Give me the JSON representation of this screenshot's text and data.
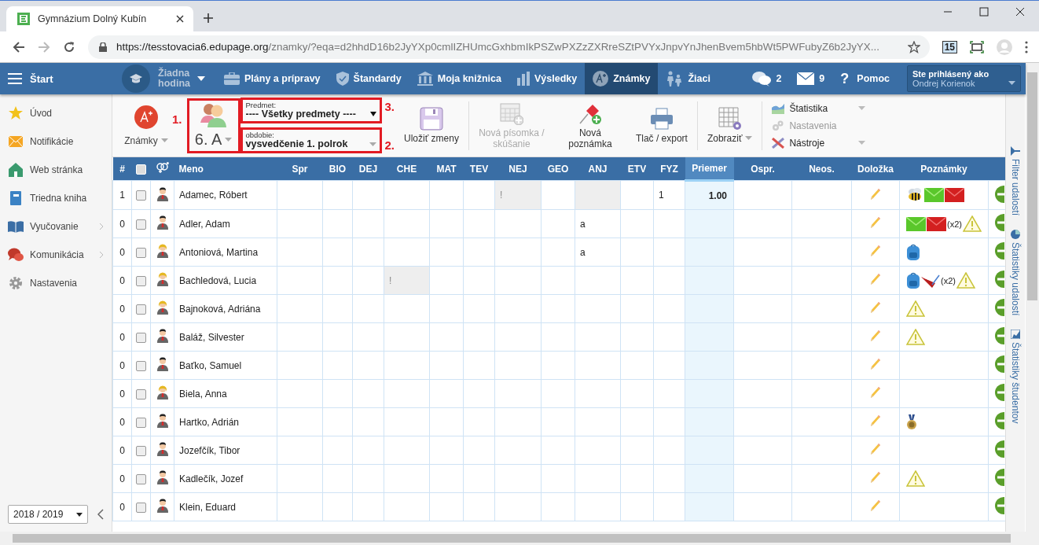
{
  "browser": {
    "tab_title": "Gymnázium Dolný Kubín",
    "url_host": "https://tesstovacia6.edupage.org",
    "url_path": "/znamky/?eqa=d2hhdD16b2JyYXp0cmlIZHUmcGxhbmIkPSZwPXZzZXRreSZtPVYxJnpvYnJhenBvem5hbWt5PWFubyZ6b2JyYX...",
    "extension_badge": "15"
  },
  "nav": {
    "start": "Štart",
    "lesson": "Žiadna hodina",
    "items": [
      {
        "label": "Plány a prípravy",
        "kind": "briefcase",
        "selected": false
      },
      {
        "label": "Štandardy",
        "kind": "shield",
        "selected": false
      },
      {
        "label": "Moja knižnica",
        "kind": "library",
        "selected": false
      },
      {
        "label": "Výsledky",
        "kind": "chart",
        "selected": false
      },
      {
        "label": "Známky",
        "kind": "grade",
        "selected": true
      },
      {
        "label": "Žiaci",
        "kind": "pupils",
        "selected": false
      }
    ],
    "chats": "2",
    "mails": "9",
    "help_glyph": "?",
    "help": "Pomoc",
    "user_caption": "Ste prihlásený ako",
    "user_name": "Ondrej Korienok"
  },
  "sidebar": {
    "items": [
      {
        "label": "Úvod",
        "kind": "star",
        "submenu": false
      },
      {
        "label": "Notifikácie",
        "kind": "mail",
        "submenu": false
      },
      {
        "label": "Web stránka",
        "kind": "home",
        "submenu": false
      },
      {
        "label": "Triedna kniha",
        "kind": "book",
        "submenu": false
      },
      {
        "label": "Vyučovanie",
        "kind": "open-book",
        "submenu": true
      },
      {
        "label": "Komunikácia",
        "kind": "chat",
        "submenu": true
      },
      {
        "label": "Nastavenia",
        "kind": "gear",
        "submenu": false
      }
    ],
    "year": "2018 / 2019"
  },
  "toolbar": {
    "grades_menu": {
      "label": "Známky",
      "marker": "1."
    },
    "class_picker": {
      "label": "6. A",
      "highlighted": true
    },
    "subject": {
      "caption": "Predmet:",
      "value": "---- Všetky predmety ----",
      "highlighted": true,
      "marker": "3."
    },
    "period": {
      "caption": "obdobie:",
      "value": "vysvedčenie 1. polrok",
      "highlighted": true,
      "marker": "2."
    },
    "buttons": [
      {
        "label": "Uložiť zmeny",
        "kind": "save",
        "disabled": false
      },
      {
        "label": "Nová písomka / skúšanie",
        "kind": "test",
        "disabled": true
      },
      {
        "label": "Nová poznámka",
        "kind": "pin",
        "disabled": false
      },
      {
        "label": "Tlač / export",
        "kind": "print",
        "disabled": false
      }
    ],
    "view": "Zobraziť",
    "menu": [
      {
        "label": "Štatistika",
        "kind": "stats",
        "disabled": false,
        "dropdown": true
      },
      {
        "label": "Nastavenia",
        "kind": "gears",
        "disabled": true,
        "dropdown": false
      },
      {
        "label": "Nástroje",
        "kind": "tools",
        "disabled": false,
        "dropdown": true
      }
    ]
  },
  "table": {
    "columns": [
      {
        "label": "#",
        "kind": "number",
        "highlighted": false
      },
      {
        "kind": "checkbox",
        "checked": false
      },
      {
        "kind": "gender"
      },
      {
        "label": "Meno",
        "kind": "name",
        "highlighted": false
      },
      {
        "label": "Spr",
        "kind": "grade",
        "highlighted": false
      },
      {
        "label": "BIO",
        "kind": "grade",
        "highlighted": false
      },
      {
        "label": "DEJ",
        "kind": "grade",
        "highlighted": false
      },
      {
        "label": "CHE",
        "kind": "grade",
        "highlighted": false
      },
      {
        "label": "MAT",
        "kind": "grade",
        "highlighted": false
      },
      {
        "label": "TEV",
        "kind": "grade",
        "highlighted": false
      },
      {
        "label": "NEJ",
        "kind": "grade",
        "highlighted": false
      },
      {
        "label": "GEO",
        "kind": "grade",
        "highlighted": false
      },
      {
        "label": "ANJ",
        "kind": "grade",
        "highlighted": false
      },
      {
        "label": "ETV",
        "kind": "grade",
        "highlighted": false
      },
      {
        "label": "FYZ",
        "kind": "grade",
        "highlighted": false
      },
      {
        "label": "Priemer",
        "kind": "grade",
        "highlighted": true
      },
      {
        "label": "Ospr.",
        "kind": "grade",
        "highlighted": false
      },
      {
        "label": "Neos.",
        "kind": "grade",
        "highlighted": false
      },
      {
        "label": "Doložka",
        "kind": "edit",
        "highlighted": false
      },
      {
        "label": "Poznámky",
        "kind": "notes",
        "highlighted": false
      }
    ],
    "rows": [
      {
        "cells": [
          "1",
          {
            "checked": false
          },
          {
            "female": false
          },
          "Adamec, Róbert",
          "",
          "",
          "",
          "",
          "",
          "",
          {
            "text": "!",
            "shaded": true
          },
          "",
          {
            "shaded": true
          },
          "",
          "1",
          "1.00",
          "",
          "",
          "",
          {
            "notes": [
              {
                "kind": "bee"
              },
              {
                "kind": "mail-green"
              },
              {
                "kind": "mail-red"
              }
            ]
          }
        ]
      },
      {
        "cells": [
          "0",
          {
            "checked": false
          },
          {
            "female": false
          },
          "Adler, Adam",
          "",
          "",
          "",
          "",
          "",
          "",
          "",
          "",
          "a",
          "",
          "",
          "",
          "",
          "",
          "",
          {
            "notes": [
              {
                "kind": "mail-green"
              },
              {
                "kind": "mail-red"
              },
              {
                "kind": "count",
                "text": "(x2)"
              },
              {
                "kind": "warning"
              }
            ]
          }
        ]
      },
      {
        "cells": [
          "0",
          {
            "checked": false
          },
          {
            "female": true
          },
          "Antoniová, Martina",
          "",
          "",
          "",
          "",
          "",
          "",
          "",
          "",
          "a",
          "",
          "",
          "",
          "",
          "",
          "",
          {
            "notes": [
              {
                "kind": "backpack"
              }
            ]
          }
        ]
      },
      {
        "cells": [
          "0",
          {
            "checked": false
          },
          {
            "female": true
          },
          "Bachledová, Lucia",
          "",
          "",
          "",
          {
            "text": "!",
            "shaded": true
          },
          "",
          "",
          "",
          "",
          "",
          "",
          "",
          "",
          "",
          "",
          "",
          {
            "notes": [
              {
                "kind": "backpack"
              },
              {
                "kind": "pen"
              },
              {
                "kind": "count",
                "text": "(x2)"
              },
              {
                "kind": "warning"
              }
            ]
          }
        ]
      },
      {
        "cells": [
          "0",
          {
            "checked": false
          },
          {
            "female": true
          },
          "Bajnoková, Adriána",
          "",
          "",
          "",
          "",
          "",
          "",
          "",
          "",
          "",
          "",
          "",
          "",
          "",
          "",
          "",
          {
            "notes": [
              {
                "kind": "warning"
              }
            ]
          }
        ]
      },
      {
        "cells": [
          "0",
          {
            "checked": false
          },
          {
            "female": false
          },
          "Baláž, Silvester",
          "",
          "",
          "",
          "",
          "",
          "",
          "",
          "",
          "",
          "",
          "",
          "",
          "",
          "",
          "",
          {
            "notes": [
              {
                "kind": "warning"
              }
            ]
          }
        ]
      },
      {
        "cells": [
          "0",
          {
            "checked": false
          },
          {
            "female": false
          },
          "Baťko, Samuel",
          "",
          "",
          "",
          "",
          "",
          "",
          "",
          "",
          "",
          "",
          "",
          "",
          "",
          "",
          "",
          ""
        ]
      },
      {
        "cells": [
          "0",
          {
            "checked": false
          },
          {
            "female": true
          },
          "Biela, Anna",
          "",
          "",
          "",
          "",
          "",
          "",
          "",
          "",
          "",
          "",
          "",
          "",
          "",
          "",
          "",
          ""
        ]
      },
      {
        "cells": [
          "0",
          {
            "checked": false
          },
          {
            "female": false
          },
          "Hartko, Adrián",
          "",
          "",
          "",
          "",
          "",
          "",
          "",
          "",
          "",
          "",
          "",
          "",
          "",
          "",
          "",
          {
            "notes": [
              {
                "kind": "medal"
              }
            ]
          }
        ]
      },
      {
        "cells": [
          "0",
          {
            "checked": false
          },
          {
            "female": false
          },
          "Jozefčík, Tibor",
          "",
          "",
          "",
          "",
          "",
          "",
          "",
          "",
          "",
          "",
          "",
          "",
          "",
          "",
          "",
          ""
        ]
      },
      {
        "cells": [
          "0",
          {
            "checked": false
          },
          {
            "female": false
          },
          "Kadlečík, Jozef",
          "",
          "",
          "",
          "",
          "",
          "",
          "",
          "",
          "",
          "",
          "",
          "",
          "",
          "",
          "",
          {
            "notes": [
              {
                "kind": "warning"
              }
            ]
          }
        ]
      },
      {
        "cells": [
          "0",
          {
            "checked": false
          },
          {
            "female": false
          },
          "Klein, Eduard",
          "",
          "",
          "",
          "",
          "",
          "",
          "",
          "",
          "",
          "",
          "",
          "",
          "",
          "",
          "",
          ""
        ]
      }
    ]
  },
  "side_panel": {
    "items": [
      {
        "label": "Filter udalostí",
        "kind": "filter"
      },
      {
        "label": "Štatistiky udalostí",
        "kind": "pie"
      },
      {
        "label": "Štatistiky študentov",
        "kind": "chart"
      }
    ]
  }
}
